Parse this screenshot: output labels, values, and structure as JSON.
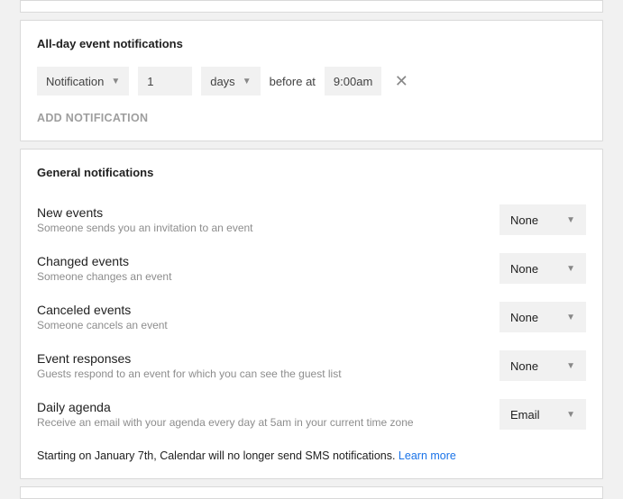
{
  "allday": {
    "title": "All-day event notifications",
    "method": "Notification",
    "value": "1",
    "unit": "days",
    "before_at": "before at",
    "time": "9:00am",
    "add": "ADD NOTIFICATION"
  },
  "general": {
    "title": "General notifications",
    "items": [
      {
        "title": "New events",
        "desc": "Someone sends you an invitation to an event",
        "value": "None"
      },
      {
        "title": "Changed events",
        "desc": "Someone changes an event",
        "value": "None"
      },
      {
        "title": "Canceled events",
        "desc": "Someone cancels an event",
        "value": "None"
      },
      {
        "title": "Event responses",
        "desc": "Guests respond to an event for which you can see the guest list",
        "value": "None"
      },
      {
        "title": "Daily agenda",
        "desc": "Receive an email with your agenda every day at 5am in your current time zone",
        "value": "Email"
      }
    ],
    "notice_text": "Starting on January 7th, Calendar will no longer send SMS notifications. ",
    "notice_link": "Learn more"
  }
}
